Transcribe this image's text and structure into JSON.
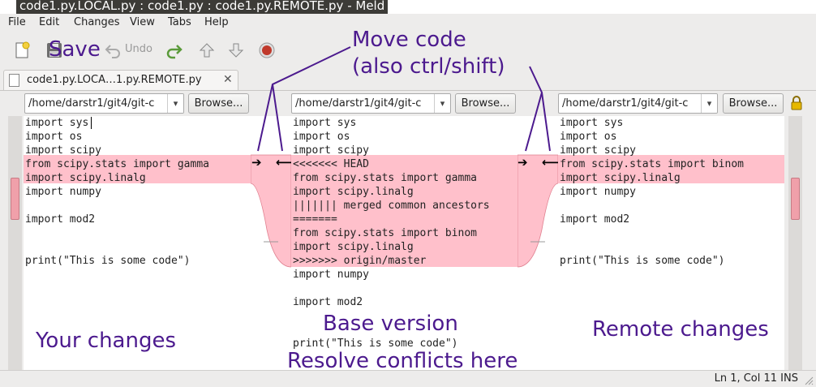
{
  "window": {
    "title": "code1.py.LOCAL.py : code1.py : code1.py.REMOTE.py - Meld"
  },
  "menu": [
    "File",
    "Edit",
    "Changes",
    "View",
    "Tabs",
    "Help"
  ],
  "toolbar": {
    "undo_label": "Undo"
  },
  "tab": {
    "label": "code1.py.LOCA…1.py.REMOTE.py",
    "close": "✕"
  },
  "paths": {
    "local": "/home/darstr1/git4/git-c",
    "base": "/home/darstr1/git4/git-c",
    "remote": "/home/darstr1/git4/git-c",
    "browse_label": "Browse..."
  },
  "panes": {
    "local": [
      "import sys",
      "import os",
      "import scipy",
      "from scipy.stats import gamma",
      "import scipy.linalg",
      "import numpy",
      "",
      "import mod2",
      "",
      "",
      "print(\"This is some code\")"
    ],
    "base": [
      "import sys",
      "import os",
      "import scipy",
      "<<<<<<< HEAD",
      "from scipy.stats import gamma",
      "import scipy.linalg",
      "||||||| merged common ancestors",
      "=======",
      "from scipy.stats import binom",
      "import scipy.linalg",
      ">>>>>>> origin/master",
      "import numpy",
      "",
      "import mod2",
      "",
      "",
      "print(\"This is some code\")"
    ],
    "remote": [
      "import sys",
      "import os",
      "import scipy",
      "from scipy.stats import binom",
      "import scipy.linalg",
      "import numpy",
      "",
      "import mod2",
      "",
      "",
      "print(\"This is some code\")"
    ]
  },
  "status": {
    "text": "Ln 1, Col 11  INS"
  },
  "annotations": {
    "save": "Save",
    "move_code_1": "Move code",
    "move_code_2": "(also ctrl/shift)",
    "your_changes": "Your changes",
    "base_version": "Base version",
    "resolve": "Resolve conflicts here",
    "remote_changes": "Remote changes"
  },
  "colors": {
    "conflict": "#ffc0cb",
    "annotation": "#4c1a8e"
  }
}
